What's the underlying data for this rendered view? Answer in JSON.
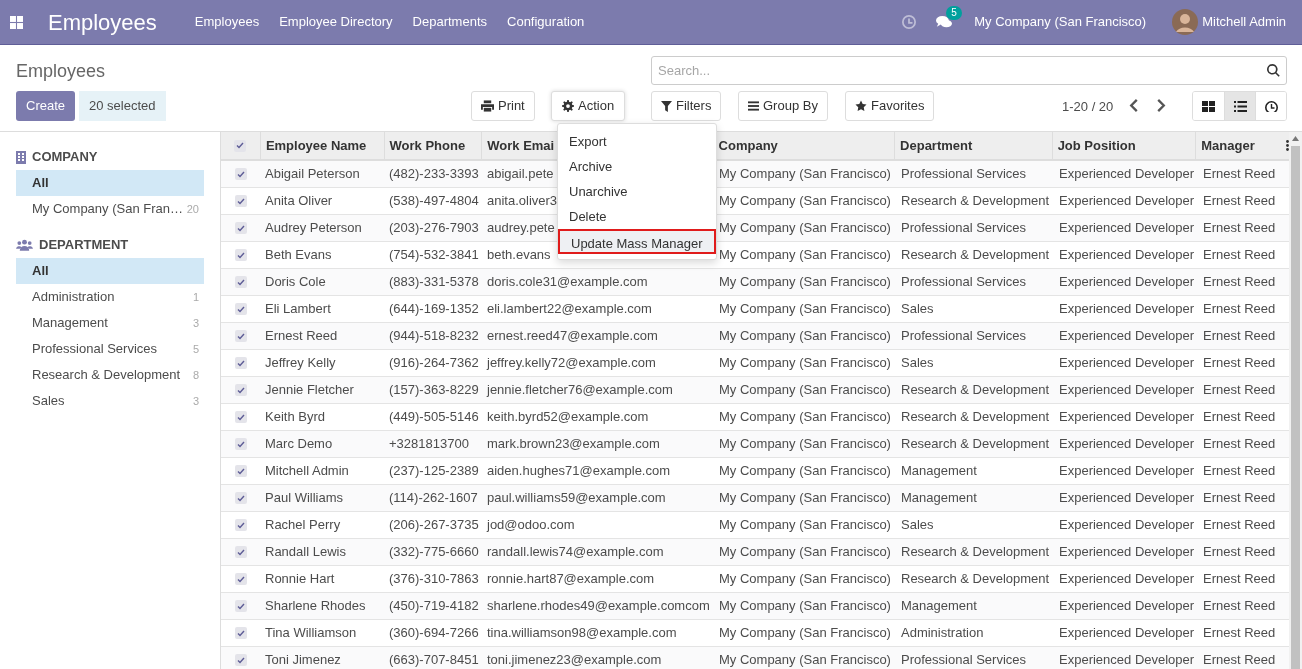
{
  "navbar": {
    "app_title": "Employees",
    "menu": [
      "Employees",
      "Employee Directory",
      "Departments",
      "Configuration"
    ],
    "message_count": "5",
    "company": "My Company (San Francisco)",
    "user": "Mitchell Admin"
  },
  "control_panel": {
    "title": "Employees",
    "create": "Create",
    "selection": "20 selected",
    "print": "Print",
    "action": "Action",
    "search": {
      "placeholder": "Search..."
    },
    "filters": "Filters",
    "group_by": "Group By",
    "favorites": "Favorites",
    "pager": "1-20 / 20",
    "views": [
      {
        "kind": "kanban",
        "selected": false
      },
      {
        "kind": "list",
        "selected": true
      },
      {
        "kind": "activity",
        "selected": false
      }
    ]
  },
  "action_menu": [
    {
      "label": "Export",
      "highlighted": false
    },
    {
      "label": "Archive",
      "highlighted": false
    },
    {
      "label": "Unarchive",
      "highlighted": false
    },
    {
      "label": "Delete",
      "highlighted": false
    },
    {
      "label": "Update Mass Manager",
      "highlighted": true
    }
  ],
  "sidebar": [
    {
      "kind": "company",
      "heading": "COMPANY",
      "items": [
        {
          "label": "All",
          "selected": true
        },
        {
          "label": "My Company (San Fran…",
          "count": "20",
          "selected": false
        }
      ]
    },
    {
      "kind": "department",
      "heading": "DEPARTMENT",
      "items": [
        {
          "label": "All",
          "selected": true
        },
        {
          "label": "Administration",
          "count": "1",
          "selected": false
        },
        {
          "label": "Management",
          "count": "3",
          "selected": false
        },
        {
          "label": "Professional Services",
          "count": "5",
          "selected": false
        },
        {
          "label": "Research & Development",
          "count": "8",
          "selected": false
        },
        {
          "label": "Sales",
          "count": "3",
          "selected": false
        }
      ]
    }
  ],
  "table": {
    "all_checked": true,
    "columns": [
      "Employee Name",
      "Work Phone",
      "Work Emai",
      "Company",
      "Department",
      "Job Position",
      "Manager"
    ],
    "rows": [
      {
        "checked": true,
        "cells": [
          "Abigail Peterson",
          "(482)-233-3393",
          "abigail.pete",
          "My Company (San Francisco)",
          "Professional Services",
          "Experienced Developer",
          "Ernest Reed"
        ]
      },
      {
        "checked": true,
        "cells": [
          "Anita Oliver",
          "(538)-497-4804",
          "anita.oliver3",
          "My Company (San Francisco)",
          "Research & Development",
          "Experienced Developer",
          "Ernest Reed"
        ]
      },
      {
        "checked": true,
        "cells": [
          "Audrey Peterson",
          "(203)-276-7903",
          "audrey.pete",
          "My Company (San Francisco)",
          "Professional Services",
          "Experienced Developer",
          "Ernest Reed"
        ]
      },
      {
        "checked": true,
        "cells": [
          "Beth Evans",
          "(754)-532-3841",
          "beth.evans",
          "My Company (San Francisco)",
          "Research & Development",
          "Experienced Developer",
          "Ernest Reed"
        ]
      },
      {
        "checked": true,
        "cells": [
          "Doris Cole",
          "(883)-331-5378",
          "doris.cole31@example.com",
          "My Company (San Francisco)",
          "Professional Services",
          "Experienced Developer",
          "Ernest Reed"
        ]
      },
      {
        "checked": true,
        "cells": [
          "Eli Lambert",
          "(644)-169-1352",
          "eli.lambert22@example.com",
          "My Company (San Francisco)",
          "Sales",
          "Experienced Developer",
          "Ernest Reed"
        ]
      },
      {
        "checked": true,
        "cells": [
          "Ernest Reed",
          "(944)-518-8232",
          "ernest.reed47@example.com",
          "My Company (San Francisco)",
          "Professional Services",
          "Experienced Developer",
          "Ernest Reed"
        ]
      },
      {
        "checked": true,
        "cells": [
          "Jeffrey Kelly",
          "(916)-264-7362",
          "jeffrey.kelly72@example.com",
          "My Company (San Francisco)",
          "Sales",
          "Experienced Developer",
          "Ernest Reed"
        ]
      },
      {
        "checked": true,
        "cells": [
          "Jennie Fletcher",
          "(157)-363-8229",
          "jennie.fletcher76@example.com",
          "My Company (San Francisco)",
          "Research & Development",
          "Experienced Developer",
          "Ernest Reed"
        ]
      },
      {
        "checked": true,
        "cells": [
          "Keith Byrd",
          "(449)-505-5146",
          "keith.byrd52@example.com",
          "My Company (San Francisco)",
          "Research & Development",
          "Experienced Developer",
          "Ernest Reed"
        ]
      },
      {
        "checked": true,
        "cells": [
          "Marc Demo",
          "+3281813700",
          "mark.brown23@example.com",
          "My Company (San Francisco)",
          "Research & Development",
          "Experienced Developer",
          "Ernest Reed"
        ]
      },
      {
        "checked": true,
        "cells": [
          "Mitchell Admin",
          "(237)-125-2389",
          "aiden.hughes71@example.com",
          "My Company (San Francisco)",
          "Management",
          "Experienced Developer",
          "Ernest Reed"
        ]
      },
      {
        "checked": true,
        "cells": [
          "Paul Williams",
          "(114)-262-1607",
          "paul.williams59@example.com",
          "My Company (San Francisco)",
          "Management",
          "Experienced Developer",
          "Ernest Reed"
        ]
      },
      {
        "checked": true,
        "cells": [
          "Rachel Perry",
          "(206)-267-3735",
          "jod@odoo.com",
          "My Company (San Francisco)",
          "Sales",
          "Experienced Developer",
          "Ernest Reed"
        ]
      },
      {
        "checked": true,
        "cells": [
          "Randall Lewis",
          "(332)-775-6660",
          "randall.lewis74@example.com",
          "My Company (San Francisco)",
          "Research & Development",
          "Experienced Developer",
          "Ernest Reed"
        ]
      },
      {
        "checked": true,
        "cells": [
          "Ronnie Hart",
          "(376)-310-7863",
          "ronnie.hart87@example.com",
          "My Company (San Francisco)",
          "Research & Development",
          "Experienced Developer",
          "Ernest Reed"
        ]
      },
      {
        "checked": true,
        "cells": [
          "Sharlene Rhodes",
          "(450)-719-4182",
          "sharlene.rhodes49@example.comcom",
          "My Company (San Francisco)",
          "Management",
          "Experienced Developer",
          "Ernest Reed"
        ]
      },
      {
        "checked": true,
        "cells": [
          "Tina Williamson",
          "(360)-694-7266",
          "tina.williamson98@example.com",
          "My Company (San Francisco)",
          "Administration",
          "Experienced Developer",
          "Ernest Reed"
        ]
      },
      {
        "checked": true,
        "cells": [
          "Toni Jimenez",
          "(663)-707-8451",
          "toni.jimenez23@example.com",
          "My Company (San Francisco)",
          "Professional Services",
          "Experienced Developer",
          "Ernest Reed"
        ]
      }
    ]
  }
}
